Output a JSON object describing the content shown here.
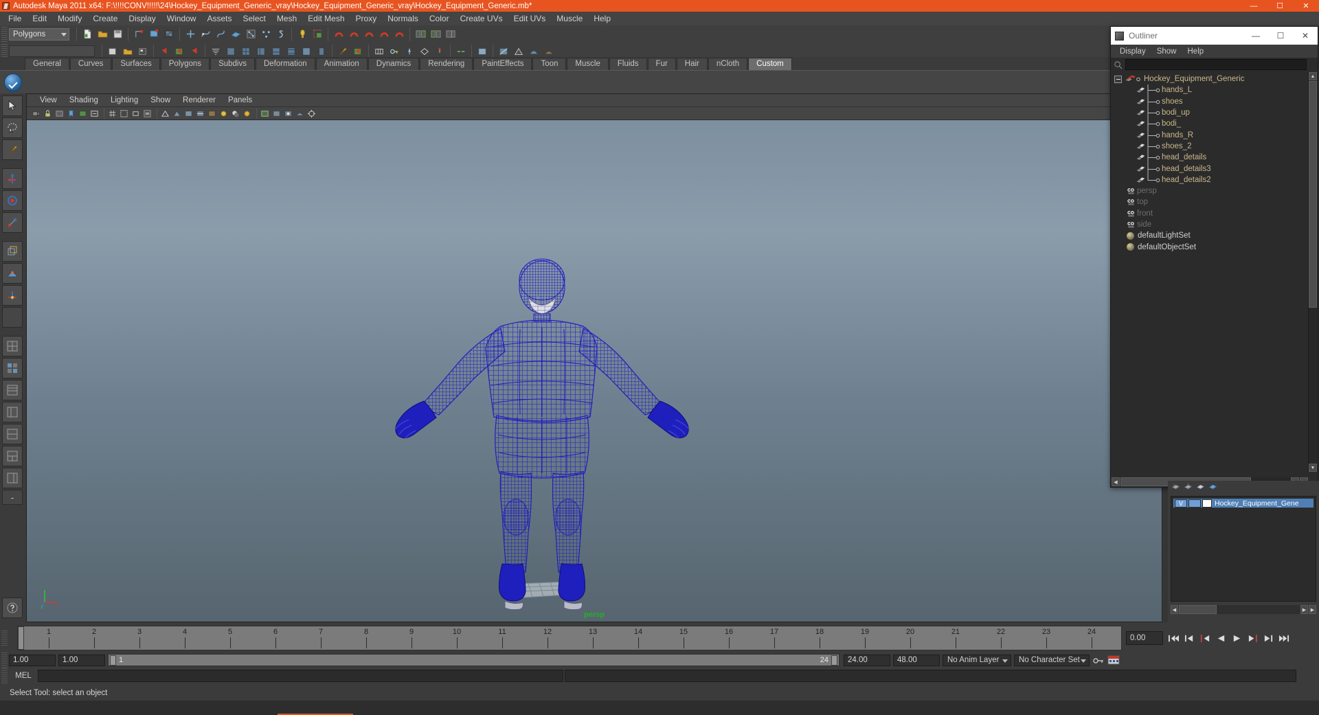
{
  "window": {
    "title": "Autodesk Maya 2011 x64: F:\\!!!!CONV!!!!!\\24\\Hockey_Equipment_Generic_vray\\Hockey_Equipment_Generic_vray\\Hockey_Equipment_Generic.mb*",
    "minimize": "—",
    "maximize": "☐",
    "close": "✕",
    "icon": "maya-app-icon"
  },
  "menubar": {
    "items": [
      "File",
      "Edit",
      "Modify",
      "Create",
      "Display",
      "Window",
      "Assets",
      "Select",
      "Mesh",
      "Edit Mesh",
      "Proxy",
      "Normals",
      "Color",
      "Create UVs",
      "Edit UVs",
      "Muscle",
      "Help"
    ]
  },
  "status_line": {
    "mode_selector": "Polygons"
  },
  "shelf": {
    "tabs": [
      "General",
      "Curves",
      "Surfaces",
      "Polygons",
      "Subdivs",
      "Deformation",
      "Animation",
      "Dynamics",
      "Rendering",
      "PaintEffects",
      "Toon",
      "Muscle",
      "Fluids",
      "Fur",
      "Hair",
      "nCloth",
      "Custom"
    ],
    "active_tab": "Custom"
  },
  "viewport": {
    "menus": [
      "View",
      "Shading",
      "Lighting",
      "Show",
      "Renderer",
      "Panels"
    ],
    "camera_label": "persp",
    "axis_y": "y",
    "axis_x": "x",
    "wireframe_color": "#1f1fbe",
    "background_top": "#7d909f",
    "background_bottom": "#56656f"
  },
  "outliner": {
    "title": "Outliner",
    "minimize": "—",
    "maximize": "☐",
    "close": "✕",
    "menus": [
      "Display",
      "Show",
      "Help"
    ],
    "search_value": "",
    "items": [
      {
        "label": "Hockey_Equipment_Generic",
        "icon": "transform-icon",
        "type": "root",
        "indent": 0,
        "dim": false
      },
      {
        "label": "hands_L",
        "icon": "mesh-icon",
        "type": "child",
        "indent": 1,
        "dim": false
      },
      {
        "label": "shoes",
        "icon": "mesh-icon",
        "type": "child",
        "indent": 1,
        "dim": false
      },
      {
        "label": "bodi_up",
        "icon": "mesh-icon",
        "type": "child",
        "indent": 1,
        "dim": false
      },
      {
        "label": "bodi_",
        "icon": "mesh-icon",
        "type": "child",
        "indent": 1,
        "dim": false
      },
      {
        "label": "hands_R",
        "icon": "mesh-icon",
        "type": "child",
        "indent": 1,
        "dim": false
      },
      {
        "label": "shoes_2",
        "icon": "mesh-icon",
        "type": "child",
        "indent": 1,
        "dim": false
      },
      {
        "label": "head_details",
        "icon": "mesh-icon",
        "type": "child",
        "indent": 1,
        "dim": false
      },
      {
        "label": "head_details3",
        "icon": "mesh-icon",
        "type": "child",
        "indent": 1,
        "dim": false
      },
      {
        "label": "head_details2",
        "icon": "mesh-icon",
        "type": "child",
        "indent": 1,
        "dim": false,
        "last": true
      },
      {
        "label": "persp",
        "icon": "camera-icon",
        "type": "camera",
        "indent": 0,
        "dim": true
      },
      {
        "label": "top",
        "icon": "camera-icon",
        "type": "camera",
        "indent": 0,
        "dim": true
      },
      {
        "label": "front",
        "icon": "camera-icon",
        "type": "camera",
        "indent": 0,
        "dim": true
      },
      {
        "label": "side",
        "icon": "camera-icon",
        "type": "camera",
        "indent": 0,
        "dim": true
      },
      {
        "label": "defaultLightSet",
        "icon": "set-icon",
        "type": "set",
        "indent": 0,
        "dim": false
      },
      {
        "label": "defaultObjectSet",
        "icon": "set-icon",
        "type": "set",
        "indent": 0,
        "dim": false
      }
    ]
  },
  "layer_editor": {
    "visibility_toggle": "V",
    "layer_name": "Hockey_Equipment_Gene"
  },
  "timeline": {
    "ticks": [
      1,
      2,
      3,
      4,
      5,
      6,
      7,
      8,
      9,
      10,
      11,
      12,
      13,
      14,
      15,
      16,
      17,
      18,
      19,
      20,
      21,
      22,
      23,
      24
    ],
    "current_frame": "0.00",
    "playback_buttons": [
      "go-to-start",
      "step-back-keyframe",
      "step-back-frame",
      "play-backwards",
      "play-forwards",
      "step-forward-frame",
      "step-forward-keyframe",
      "go-to-end"
    ]
  },
  "range_slider": {
    "anim_start": "1.00",
    "anim_end": "1.00",
    "range_start": "1",
    "range_end": "24",
    "playback_end": "24.00",
    "anim_total_end": "48.00",
    "anim_layer": "No Anim Layer",
    "character_set": "No Character Set"
  },
  "command_line": {
    "label": "MEL",
    "value": ""
  },
  "help_line": {
    "text": "Select Tool: select an object"
  }
}
